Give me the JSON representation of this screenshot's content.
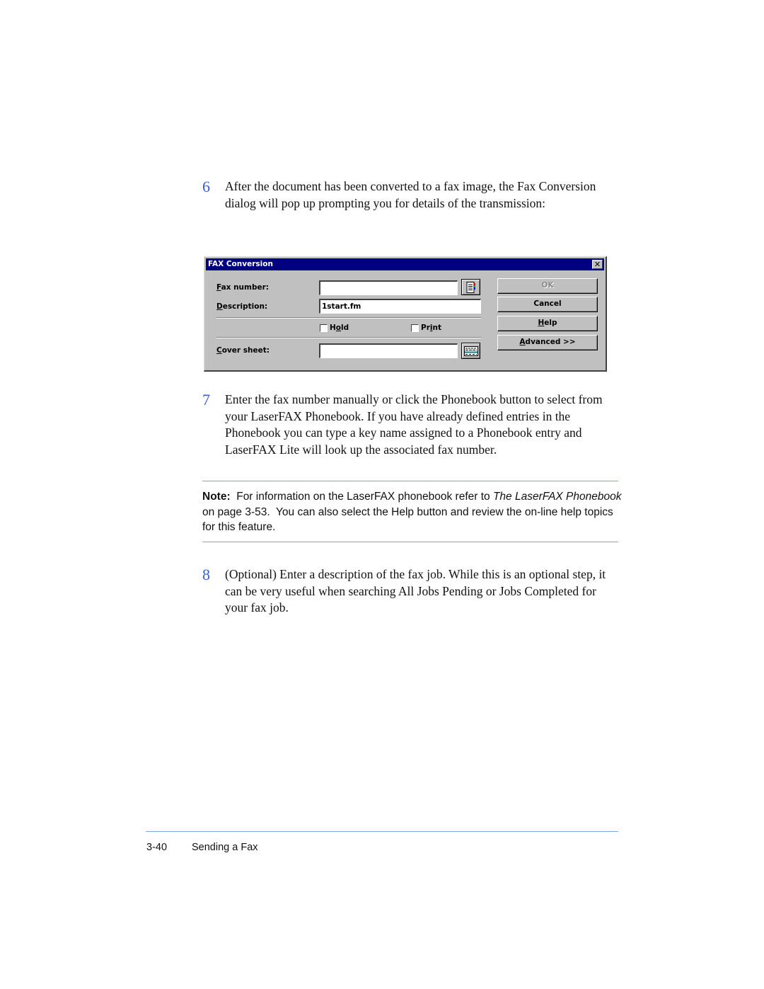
{
  "steps": [
    {
      "number": "6",
      "text": "After the document has been converted to a fax image, the Fax Conversion dialog will pop up prompting you for details of the transmission:"
    },
    {
      "number": "7",
      "text": "Enter the fax number manually or click the Phonebook button to select from your LaserFAX Phonebook.  If you have already defined entries in the Phonebook you can type a key name assigned to a Phonebook entry and LaserFAX Lite will look up the associated fax number."
    },
    {
      "number": "8",
      "text": "(Optional) Enter a description of the fax job.  While this is an optional step, it can be very useful when searching All Jobs Pending or Jobs Completed for your fax job."
    }
  ],
  "dialog": {
    "title": "FAX Conversion",
    "close_icon": "close-icon",
    "fax_number": {
      "label_mnemonic": "F",
      "label_rest": "ax number:",
      "value": ""
    },
    "description": {
      "label_mnemonic": "D",
      "label_rest": "escription:",
      "value": "1start.fm"
    },
    "phonebook_icon": "phonebook-icon",
    "hold": {
      "pre": "H",
      "mnemonic": "o",
      "post": "ld",
      "checked": false
    },
    "print": {
      "pre": "Pr",
      "mnemonic": "i",
      "post": "nt",
      "checked": false
    },
    "cover_sheet": {
      "label_mnemonic": "C",
      "label_rest": "over sheet:",
      "value": ""
    },
    "cover_sheet_icon": "cover-sheet-icon",
    "buttons": {
      "ok": "OK",
      "cancel": "Cancel",
      "help_mnemonic": "H",
      "help_rest": "elp",
      "advanced_mnemonic": "A",
      "advanced_rest": "dvanced >>"
    }
  },
  "note": {
    "label": "Note:",
    "text_before": "  For information on the LaserFAX phonebook refer to ",
    "italic_ref": "The LaserFAX Phonebook",
    "text_after": " on page 3-53.  You can also select the Help button and review the on-line help topics for this feature."
  },
  "footer": {
    "page_number": "3-40",
    "section": "Sending a Fax"
  }
}
